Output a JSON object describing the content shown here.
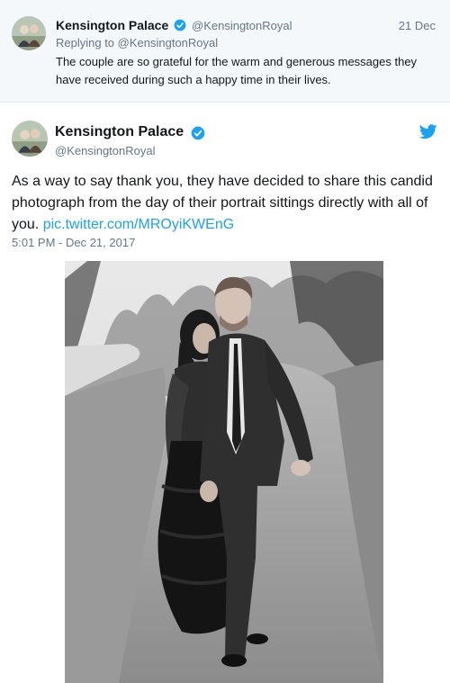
{
  "parent_tweet": {
    "name": "Kensington Palace",
    "handle": "@KensingtonRoyal",
    "date": "21 Dec",
    "replying_prefix": "Replying to ",
    "replying_handle": "@KensingtonRoyal",
    "text": "The couple are so grateful for the warm and generous messages they have received during such a happy time in their lives.",
    "avatar_icon": "kensington-avatar",
    "verified_icon": "verified-badge"
  },
  "tweet": {
    "name": "Kensington Palace",
    "handle": "@KensingtonRoyal",
    "text": "As a way to say thank you, they have decided to share this candid photograph from the day of their portrait sittings directly with all of you. ",
    "link": "pic.twitter.com/MROyiKWEnG",
    "timestamp": "5:01 PM - Dec 21, 2017",
    "avatar_icon": "kensington-avatar",
    "verified_icon": "verified-badge",
    "brand_icon": "twitter-bird",
    "media": "black-and-white photograph of a couple walking arm in arm on a garden path"
  },
  "colors": {
    "accent": "#1da1f2",
    "text": "#14171a",
    "muted": "#657786",
    "parent_background": "#f5f8fa"
  }
}
